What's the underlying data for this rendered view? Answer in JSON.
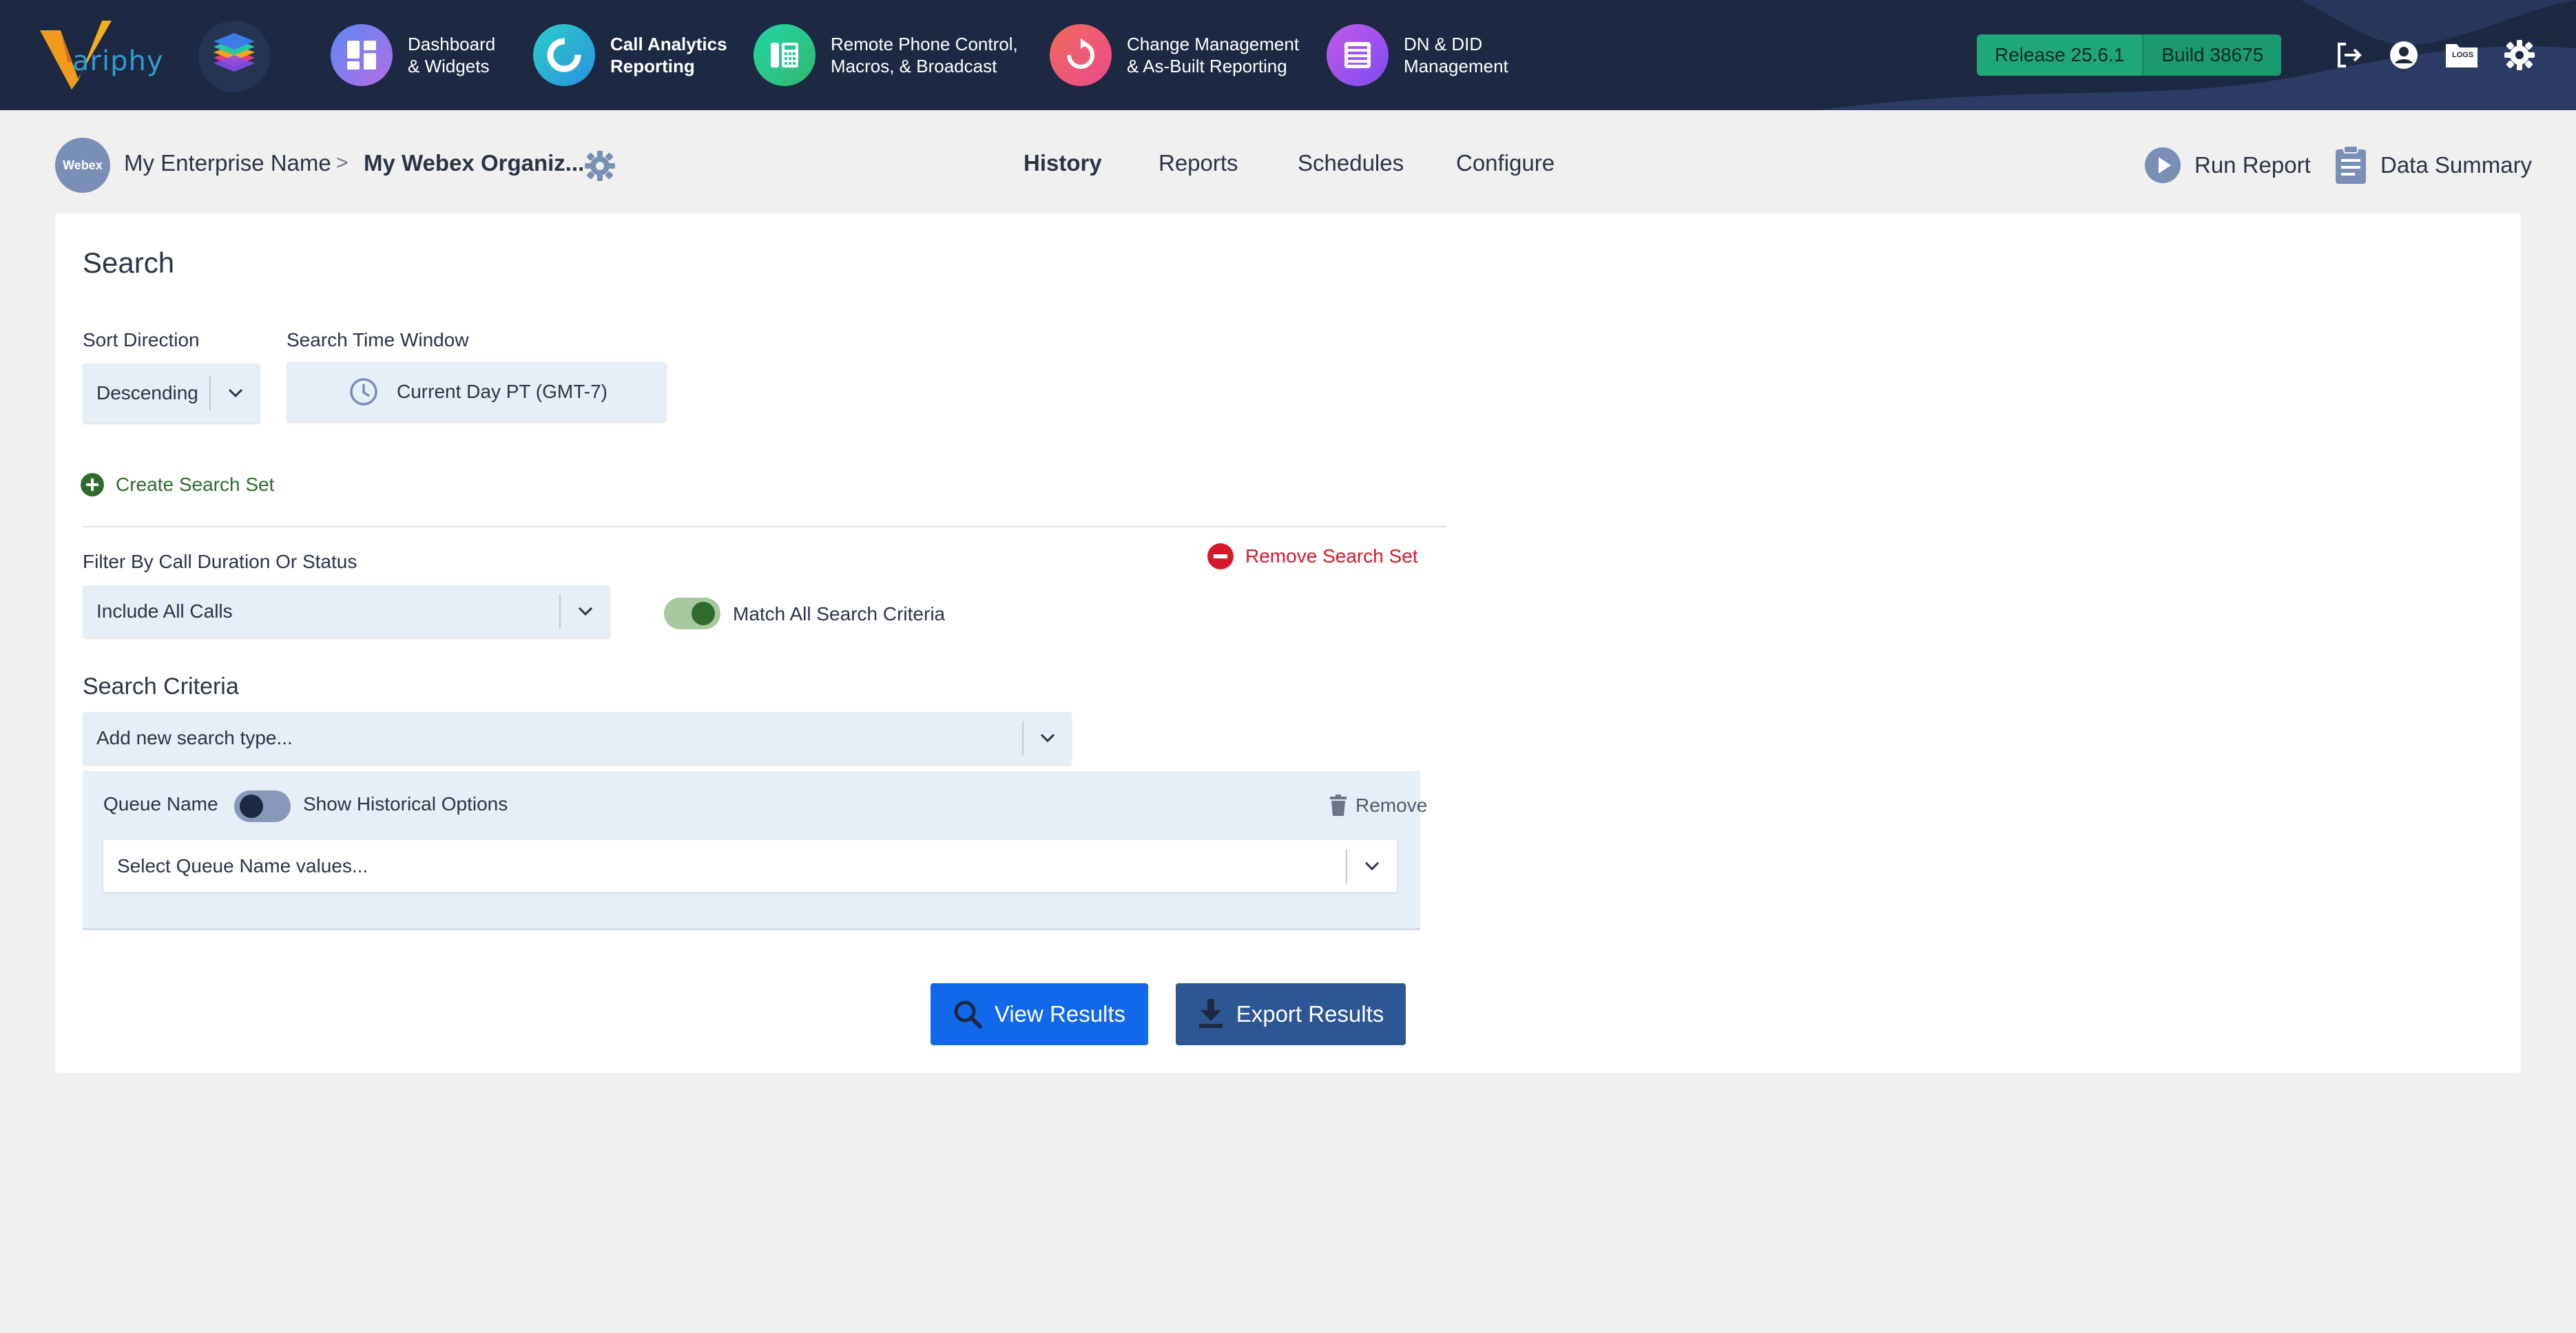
{
  "app": {
    "logo_text": "ariphy"
  },
  "nav": {
    "items": [
      {
        "label": "Dashboard\n& Widgets",
        "icon": "dashboard-icon",
        "color": "#8b6cf0"
      },
      {
        "label": "Call Analytics\nReporting",
        "icon": "call-analytics-icon",
        "color": "#2bb3d6",
        "active": true
      },
      {
        "label": "Remote Phone Control,\nMacros, & Broadcast",
        "icon": "phone-control-icon",
        "color": "#27c7a0"
      },
      {
        "label": "Change Management\n& As-Built Reporting",
        "icon": "change-management-icon",
        "color": "#f0587a"
      },
      {
        "label": "DN & DID\nManagement",
        "icon": "dn-did-icon",
        "color": "#a652f0"
      }
    ],
    "release": "Release 25.6.1",
    "build": "Build 38675",
    "right_icons": [
      "logout-icon",
      "user-account-icon",
      "logs-folder-icon",
      "settings-gear-icon"
    ],
    "logs_label": "LOGS"
  },
  "header": {
    "avatar_text": "Webex",
    "enterprise": "My Enterprise Name",
    "separator": ">",
    "org": "My Webex Organiz...",
    "tabs": [
      "History",
      "Reports",
      "Schedules",
      "Configure"
    ],
    "active_tab": "History",
    "run_report": "Run Report",
    "data_summary": "Data Summary"
  },
  "search": {
    "title": "Search",
    "sort_direction_label": "Sort Direction",
    "sort_direction_value": "Descending",
    "time_window_label": "Search Time Window",
    "time_window_value": "Current Day PT (GMT-7)",
    "create_search_set": "Create Search Set",
    "remove_search_set": "Remove Search Set",
    "filter_label": "Filter By Call Duration Or Status",
    "filter_value": "Include All Calls",
    "match_all_label": "Match All Search Criteria",
    "match_all_on": true,
    "criteria_title": "Search Criteria",
    "add_search_placeholder": "Add new search type...",
    "queue_name_label": "Queue Name",
    "historical_label": "Show Historical Options",
    "historical_on": false,
    "remove_label": "Remove",
    "queue_select_placeholder": "Select Queue Name values...",
    "view_results": "View Results",
    "export_results": "Export Results"
  },
  "colors": {
    "topbar": "#1d2842",
    "primary_button": "#1268ea",
    "export_button": "#2d5695",
    "release_badge": "#1fa779",
    "remove_red": "#d7182a",
    "create_green": "#2f6b2f",
    "panel_bg": "#e6eef8"
  }
}
